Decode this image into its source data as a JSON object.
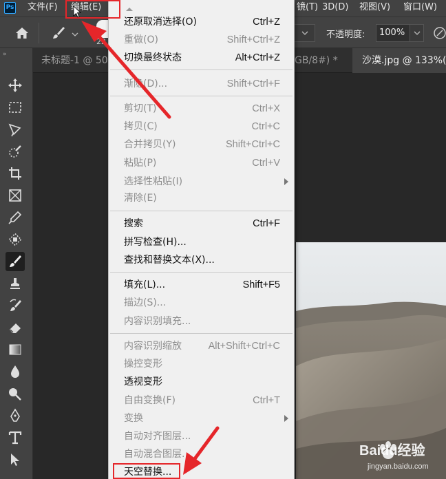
{
  "app": {
    "logo_text": "Ps"
  },
  "menubar": {
    "items": [
      {
        "label": "文件(F)"
      },
      {
        "label": "编辑(E)"
      },
      {
        "label": "镜(T)"
      },
      {
        "label": "3D(D)"
      },
      {
        "label": "视图(V)"
      },
      {
        "label": "窗口(W)"
      }
    ]
  },
  "options": {
    "brush_size": "22",
    "opacity_label": "不透明度:",
    "opacity_value": "100%"
  },
  "tabs": [
    {
      "label": "未标题-1 @ 50"
    },
    {
      "label": "GB/8#) *"
    },
    {
      "label": "沙漠.jpg @ 133%("
    }
  ],
  "edit_menu": {
    "groups": [
      [
        {
          "label": "还原取消选择(O)",
          "shortcut": "Ctrl+Z",
          "enabled": true
        },
        {
          "label": "重做(O)",
          "shortcut": "Shift+Ctrl+Z",
          "enabled": false
        },
        {
          "label": "切换最终状态",
          "shortcut": "Alt+Ctrl+Z",
          "enabled": true
        }
      ],
      [
        {
          "label": "渐隐(D)...",
          "shortcut": "Shift+Ctrl+F",
          "enabled": false
        }
      ],
      [
        {
          "label": "剪切(T)",
          "shortcut": "Ctrl+X",
          "enabled": false
        },
        {
          "label": "拷贝(C)",
          "shortcut": "Ctrl+C",
          "enabled": false
        },
        {
          "label": "合并拷贝(Y)",
          "shortcut": "Shift+Ctrl+C",
          "enabled": false
        },
        {
          "label": "粘贴(P)",
          "shortcut": "Ctrl+V",
          "enabled": false
        },
        {
          "label": "选择性粘贴(I)",
          "shortcut": "",
          "enabled": false,
          "submenu": true
        },
        {
          "label": "清除(E)",
          "shortcut": "",
          "enabled": false
        }
      ],
      [
        {
          "label": "搜索",
          "shortcut": "Ctrl+F",
          "enabled": true
        },
        {
          "label": "拼写检查(H)...",
          "shortcut": "",
          "enabled": true
        },
        {
          "label": "查找和替换文本(X)...",
          "shortcut": "",
          "enabled": true
        }
      ],
      [
        {
          "label": "填充(L)...",
          "shortcut": "Shift+F5",
          "enabled": true
        },
        {
          "label": "描边(S)...",
          "shortcut": "",
          "enabled": false
        },
        {
          "label": "内容识别填充...",
          "shortcut": "",
          "enabled": false
        }
      ],
      [
        {
          "label": "内容识别缩放",
          "shortcut": "Alt+Shift+Ctrl+C",
          "enabled": false
        },
        {
          "label": "操控变形",
          "shortcut": "",
          "enabled": false
        },
        {
          "label": "透视变形",
          "shortcut": "",
          "enabled": true
        },
        {
          "label": "自由变换(F)",
          "shortcut": "Ctrl+T",
          "enabled": false
        },
        {
          "label": "变换",
          "shortcut": "",
          "enabled": false,
          "submenu": true
        },
        {
          "label": "自动对齐图层...",
          "shortcut": "",
          "enabled": false
        },
        {
          "label": "自动混合图层...",
          "shortcut": "",
          "enabled": false
        },
        {
          "label": "天空替换...",
          "shortcut": "",
          "enabled": true
        }
      ]
    ]
  },
  "watermark": {
    "brand": "Baidu经验",
    "url": "jingyan.baidu.com"
  },
  "colors": {
    "highlight": "#e5262a",
    "menu_bg": "#f0f0f0",
    "chrome": "#424242"
  }
}
